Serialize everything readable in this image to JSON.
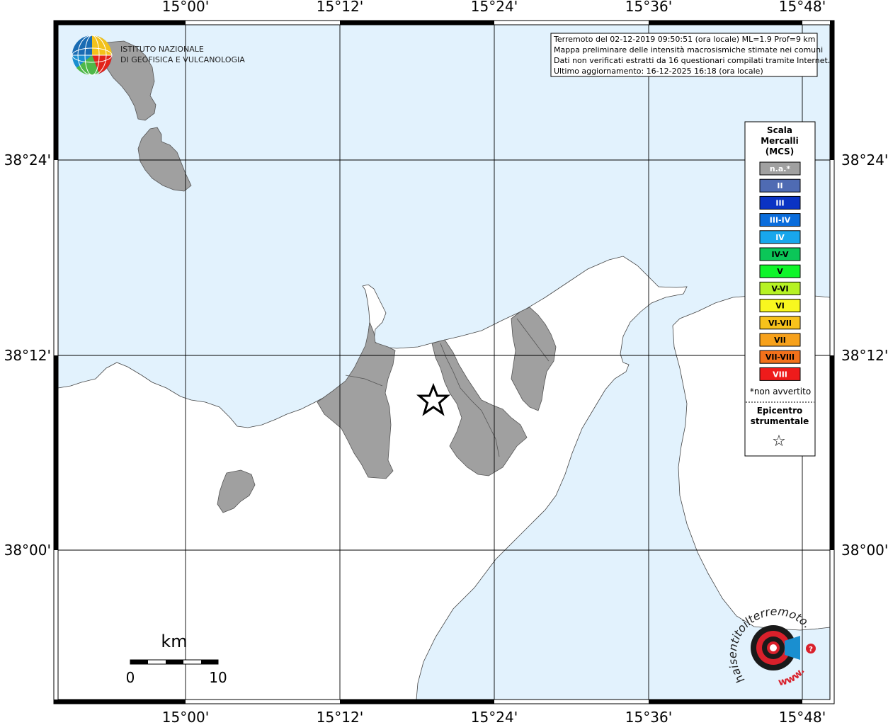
{
  "map": {
    "ticks_top_bottom": [
      "15°00'",
      "15°12'",
      "15°24'",
      "15°36'",
      "15°48'"
    ],
    "ticks_left_right": [
      "38°24'",
      "38°12'",
      "38°00'"
    ]
  },
  "info": {
    "lines": [
      "Terremoto del 02-12-2019 09:50:51 (ora locale) ML=1.9 Prof=9 km",
      "Mappa preliminare delle intensità macrosismiche stimate nei comuni",
      "Dati non verificati estratti da 16 questionari compilati tramite Internet.",
      "Ultimo aggiornamento: 16-12-2025 16:18 (ora locale)"
    ]
  },
  "logo": {
    "line1": "ISTITUTO NAZIONALE",
    "line2": "DI GEOFISICA E VULCANOLOGIA"
  },
  "legend": {
    "title_lines": [
      "Scala",
      "Mercalli",
      "(MCS)"
    ],
    "items": [
      {
        "label": "n.a.*",
        "color": "#a0a0a0"
      },
      {
        "label": "II",
        "color": "#4f6bb3"
      },
      {
        "label": "III",
        "color": "#0a33c4"
      },
      {
        "label": "III-IV",
        "color": "#0a6ddc"
      },
      {
        "label": "IV",
        "color": "#18a7ec"
      },
      {
        "label": "IV-V",
        "color": "#0bc658"
      },
      {
        "label": "V",
        "color": "#0ef52a"
      },
      {
        "label": "V-VI",
        "color": "#b6f224"
      },
      {
        "label": "VI",
        "color": "#f8f71f"
      },
      {
        "label": "VI-VII",
        "color": "#f7c21b"
      },
      {
        "label": "VII",
        "color": "#f7a11b"
      },
      {
        "label": "VII-VIII",
        "color": "#f2711b"
      },
      {
        "label": "VIII",
        "color": "#ee1b1b"
      }
    ],
    "not_felt_note": "*non avvertito",
    "epicenter_lines": [
      "Epicentro",
      "strumentale"
    ],
    "epicenter_symbol": "☆"
  },
  "scalebar": {
    "unit": "km",
    "labels": [
      "0",
      "10"
    ]
  },
  "watermark": {
    "text": "haisentitoilterremoto.it",
    "prefix": "www."
  },
  "colors": {
    "sea": "#e2f2fd",
    "land": "#ffffff",
    "municipality_na": "#a0a0a0",
    "grid": "#000000"
  }
}
